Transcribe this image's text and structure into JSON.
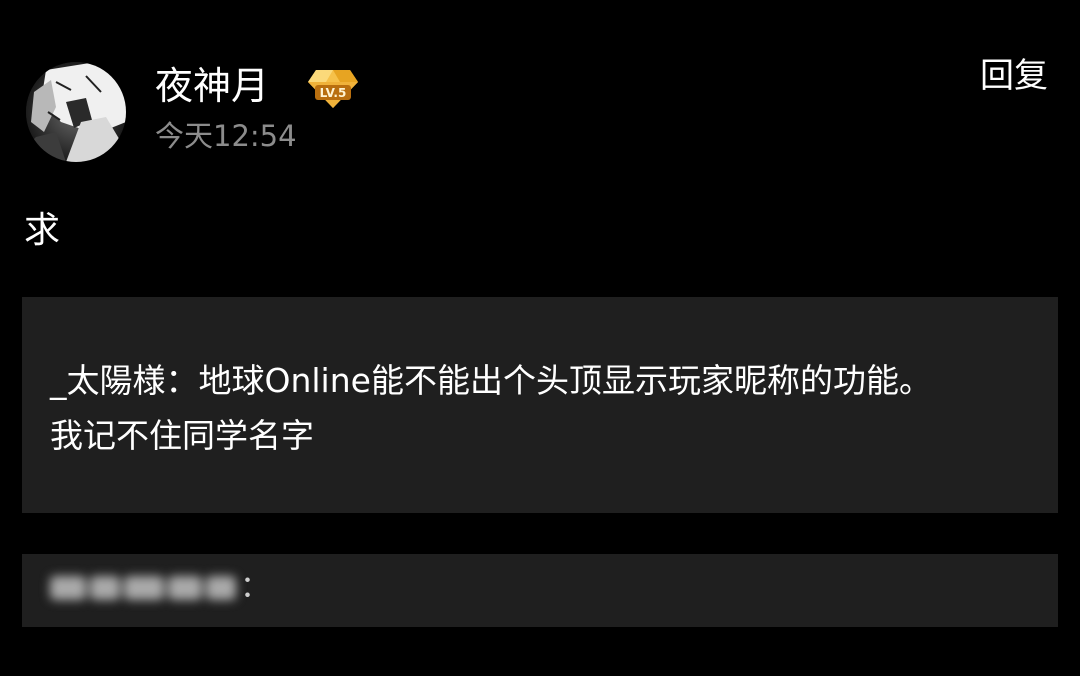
{
  "post": {
    "username": "夜神月",
    "timestamp": "今天12:54",
    "reply_label": "回复",
    "level_badge": {
      "text": "LV.5",
      "icon": "diamond-level-icon",
      "color": "#f3b430"
    },
    "avatar": {
      "icon": "anime-avatar-image"
    },
    "content": "求"
  },
  "quote": {
    "author": "_太陽様：",
    "line1_text": "地球Online能不能出个头顶显示玩家昵称的功能。",
    "line2_text": "我记不住同学名字"
  },
  "sub_reply": {
    "colon": "："
  },
  "colors": {
    "background": "#000000",
    "card": "#1f1f1f",
    "text": "#ffffff",
    "muted": "#8c8c8c"
  }
}
